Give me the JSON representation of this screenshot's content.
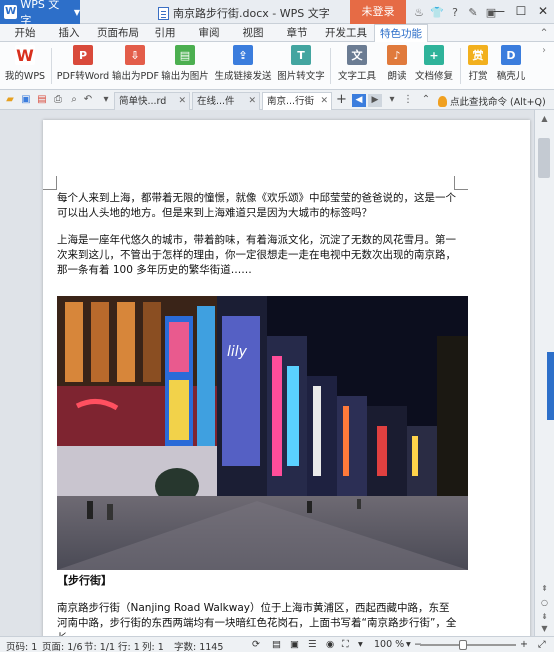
{
  "app": {
    "name": "WPS 文字",
    "window_title": "南京路步行街.docx - WPS 文字",
    "login_label": "未登录"
  },
  "menu": {
    "tabs": [
      "开始",
      "插入",
      "页面布局",
      "引用",
      "审阅",
      "视图",
      "章节",
      "开发工具",
      "特色功能"
    ],
    "active": "特色功能"
  },
  "ribbon": {
    "buttons": [
      {
        "label": "我的WPS",
        "icon": "wps-logo-icon"
      },
      {
        "label": "PDF转Word",
        "icon": "pdf-to-word-icon"
      },
      {
        "label": "输出为PDF",
        "icon": "export-pdf-icon"
      },
      {
        "label": "输出为图片",
        "icon": "export-image-icon"
      },
      {
        "label": "生成链接发送",
        "icon": "share-link-icon"
      },
      {
        "label": "图片转文字",
        "icon": "image-to-text-icon"
      },
      {
        "label": "文字工具",
        "icon": "text-tools-icon"
      },
      {
        "label": "朗读",
        "icon": "read-aloud-icon"
      },
      {
        "label": "文档修复",
        "icon": "doc-repair-icon"
      },
      {
        "label": "打赏",
        "icon": "reward-icon"
      },
      {
        "label": "稿壳儿",
        "icon": "gaokeer-icon"
      }
    ]
  },
  "doc_tabs": [
    {
      "label": "简单快...rd"
    },
    {
      "label": "在线...件"
    },
    {
      "label": "南京...行街"
    }
  ],
  "search_command": "点此查找命令 (Alt+Q)",
  "document": {
    "paragraph1": "每个人来到上海，都带着无限的憧憬，就像《欢乐颂》中邱莹莹的爸爸说的，这是一个可以出人头地的地方。但是来到上海难道只是因为大城市的标签吗？",
    "paragraph2": "上海是一座年代悠久的城市，带着韵味，有着海派文化，沉淀了无数的风花雪月。第一次来到这儿，不管出于怎样的理由，你一定很想走一走在电视中无数次出现的南京路，那一条有着 100 多年历史的繁华街道……",
    "heading": "【步行街】",
    "paragraph4": "南京路步行街（Nanjing Road Walkway）位于上海市黄浦区，西起西藏中路，东至河南中路，步行街的东西两端均有一块暗红色花岗石，上面书写着“南京路步行街”，全长"
  },
  "status": {
    "page_code": "页码: 1",
    "page": "页面: 1/6",
    "section": "节: 1/1",
    "row": "行: 1",
    "col": "列: 1",
    "word_count": "字数: 1145",
    "zoom": "100 %",
    "zoom_fraction": 0.45
  },
  "colors": {
    "accent": "#2d6fc9",
    "login": "#e66b45"
  }
}
